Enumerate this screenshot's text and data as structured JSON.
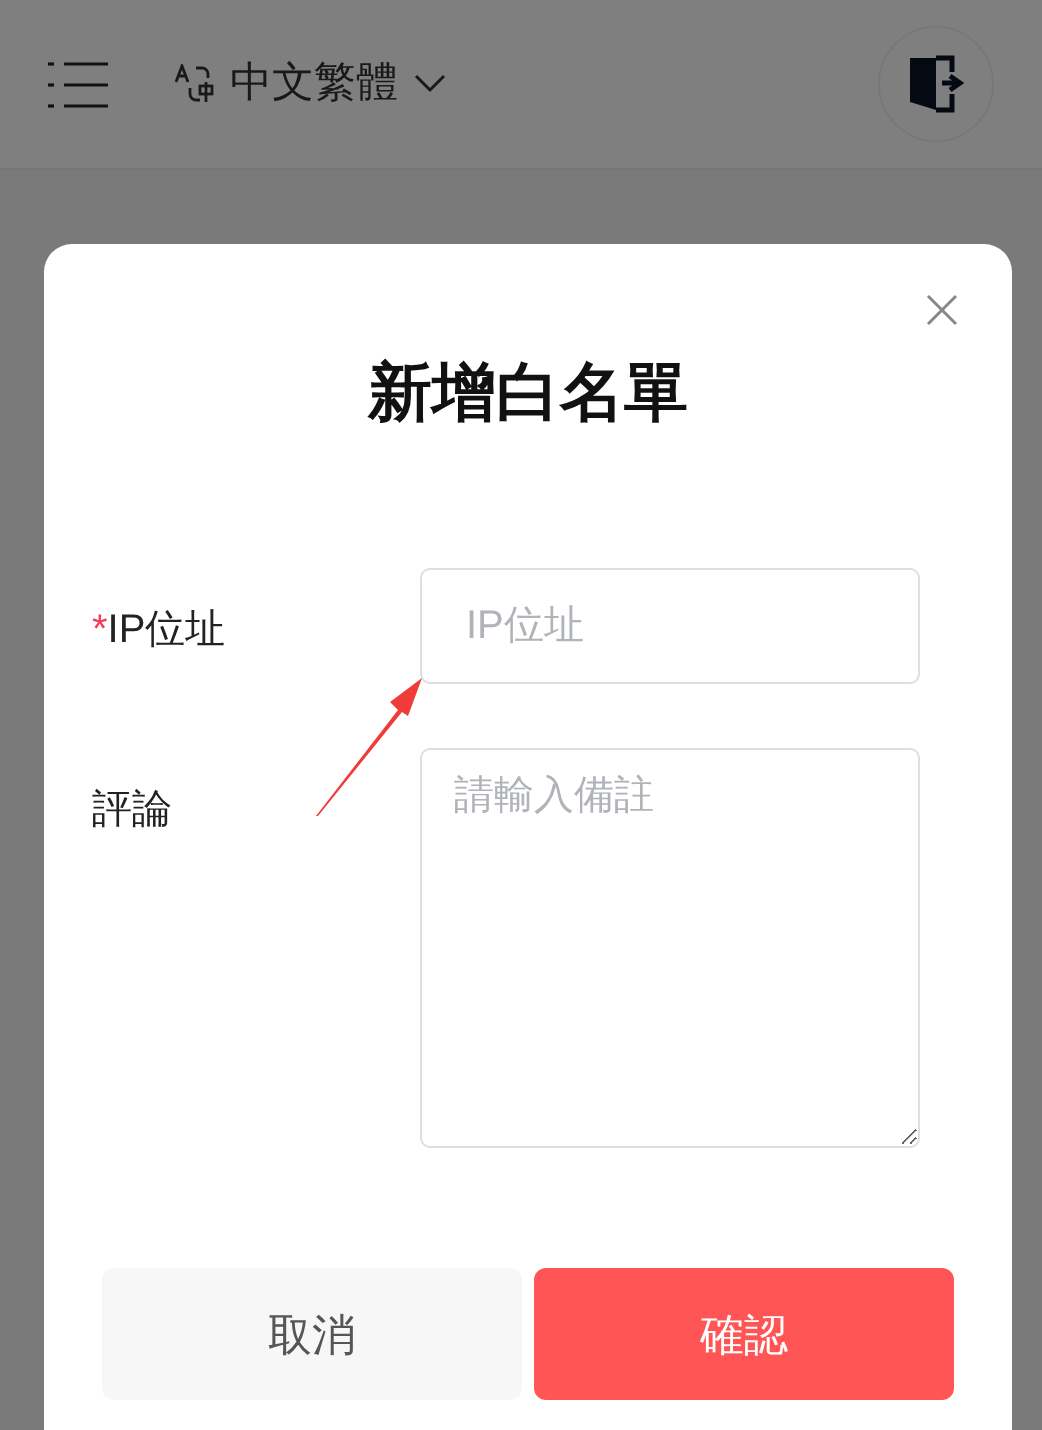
{
  "header": {
    "language": "中文繁體"
  },
  "dialog": {
    "title": "新增白名單",
    "fields": [
      {
        "kind": "input",
        "label": "IP位址",
        "required_mark": "*",
        "placeholder": "IP位址"
      },
      {
        "kind": "textarea",
        "label": "評論",
        "placeholder": "請輸入備註"
      }
    ],
    "buttons": [
      {
        "kind": "secondary",
        "label": "取消"
      },
      {
        "kind": "primary",
        "label": "確認"
      }
    ]
  }
}
